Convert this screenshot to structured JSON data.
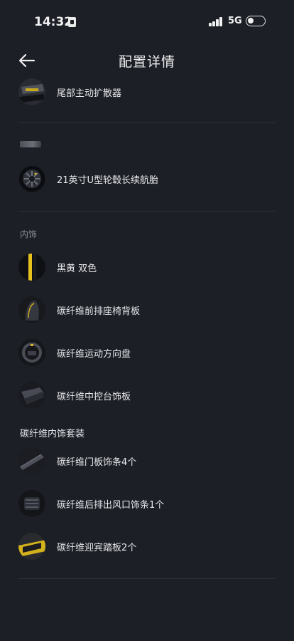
{
  "status_bar": {
    "time": "14:32",
    "network": "5G"
  },
  "header": {
    "title": "配置详情"
  },
  "exterior": {
    "items": [
      {
        "label": "尾部主动扩散器",
        "icon": "diffuser-thumbnail"
      },
      {
        "label": "21英寸U型轮毂长续航胎",
        "icon": "wheel-thumbnail"
      }
    ]
  },
  "interior": {
    "section_label": "内饰",
    "items": [
      {
        "label": "黑黄 双色",
        "icon": "color-swatch-black-yellow"
      },
      {
        "label": "碳纤维前排座椅背板",
        "icon": "seat-back-thumbnail"
      },
      {
        "label": "碳纤维运动方向盘",
        "icon": "steering-wheel-thumbnail"
      },
      {
        "label": "碳纤维中控台饰板",
        "icon": "console-trim-thumbnail"
      }
    ]
  },
  "carbon_package": {
    "label": "碳纤维内饰套装",
    "items": [
      {
        "label": "碳纤维门板饰条4个",
        "icon": "door-trim-thumbnail"
      },
      {
        "label": "碳纤维后排出风口饰条1个",
        "icon": "air-vent-trim-thumbnail"
      },
      {
        "label": "碳纤维迎宾踏板2个",
        "icon": "sill-plate-thumbnail"
      }
    ]
  },
  "colors": {
    "background": "#1c1f26",
    "accent_yellow": "#e8c21c",
    "divider": "#2e323b"
  }
}
